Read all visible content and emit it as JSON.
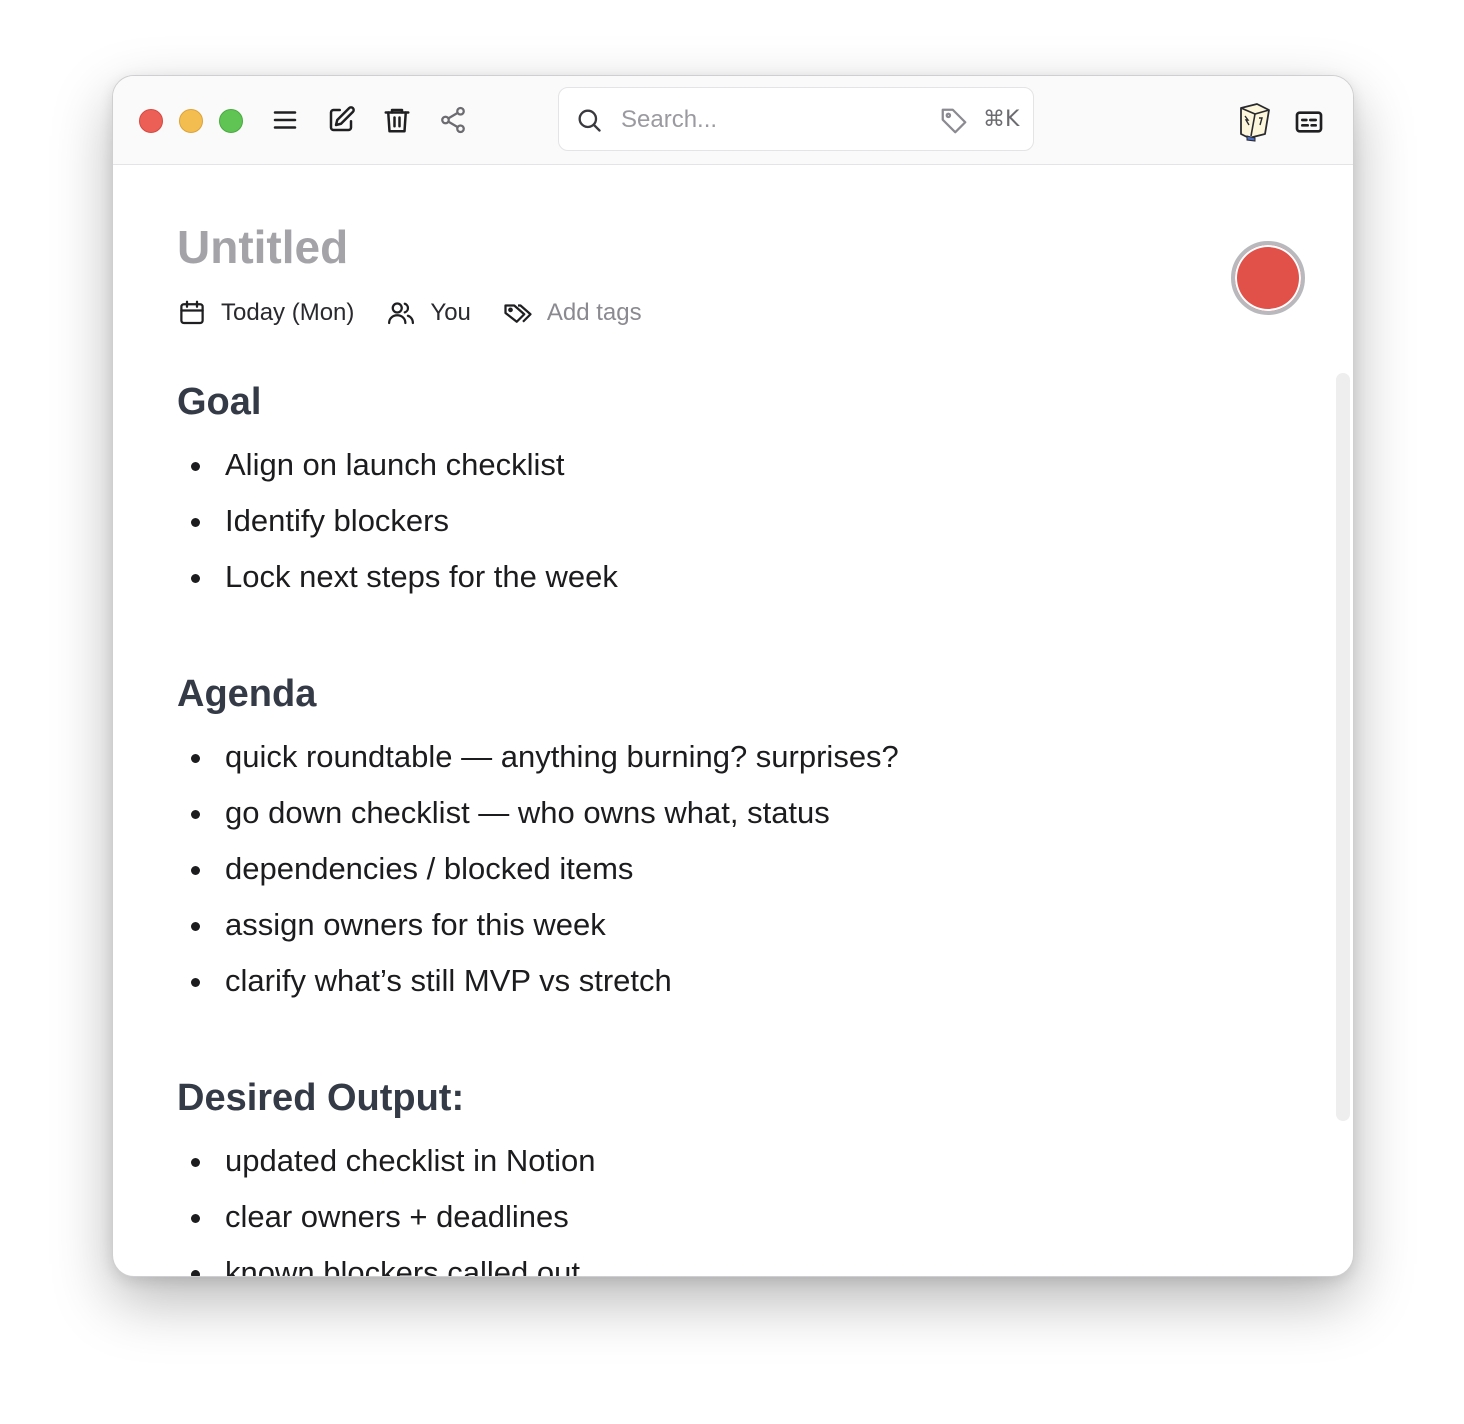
{
  "window": {
    "controls": [
      "close",
      "minimize",
      "zoom"
    ]
  },
  "toolbar": {
    "icons": [
      "menu-icon",
      "compose-icon",
      "trash-icon",
      "share-icon"
    ],
    "search_placeholder": "Search...",
    "search_shortcut": "⌘K",
    "right_icons": [
      "book-icon",
      "card-icon"
    ]
  },
  "document": {
    "title": "Untitled",
    "meta": {
      "date": "Today (Mon)",
      "people": "You",
      "tags": "Add tags"
    },
    "sections": [
      {
        "heading": "Goal",
        "items": [
          "Align on launch checklist",
          "Identify blockers",
          "Lock next steps for the week"
        ]
      },
      {
        "heading": "Agenda",
        "items": [
          "quick roundtable — anything burning? surprises?",
          "go down checklist — who owns what, status",
          "dependencies / blocked items",
          "assign owners for this week",
          "clarify what’s still MVP vs stretch"
        ]
      },
      {
        "heading": "Desired Output:",
        "items": [
          "updated checklist in Notion",
          "clear owners + deadlines",
          "known blockers called out"
        ]
      }
    ]
  },
  "colors": {
    "record": "#e2504a",
    "heading": "#343a46",
    "title": "#a3a3a8"
  }
}
